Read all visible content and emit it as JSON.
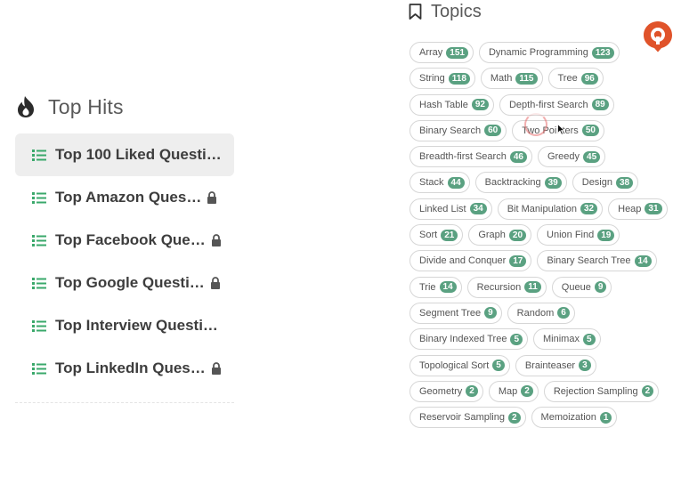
{
  "top_hits": {
    "title": "Top Hits",
    "items": [
      {
        "label": "Top 100 Liked Questi…",
        "locked": false,
        "active": true
      },
      {
        "label": "Top Amazon Ques…",
        "locked": true,
        "active": false
      },
      {
        "label": "Top Facebook Que…",
        "locked": true,
        "active": false
      },
      {
        "label": "Top Google Questi…",
        "locked": true,
        "active": false
      },
      {
        "label": "Top Interview Questi…",
        "locked": false,
        "active": false
      },
      {
        "label": "Top LinkedIn Ques…",
        "locked": true,
        "active": false
      }
    ]
  },
  "topics": {
    "title": "Topics",
    "tags": [
      {
        "name": "Array",
        "count": "151"
      },
      {
        "name": "Dynamic Programming",
        "count": "123"
      },
      {
        "name": "String",
        "count": "118"
      },
      {
        "name": "Math",
        "count": "115"
      },
      {
        "name": "Tree",
        "count": "96"
      },
      {
        "name": "Hash Table",
        "count": "92"
      },
      {
        "name": "Depth-first Search",
        "count": "89"
      },
      {
        "name": "Binary Search",
        "count": "60"
      },
      {
        "name": "Two Pointers",
        "count": "50"
      },
      {
        "name": "Breadth-first Search",
        "count": "46"
      },
      {
        "name": "Greedy",
        "count": "45"
      },
      {
        "name": "Stack",
        "count": "44"
      },
      {
        "name": "Backtracking",
        "count": "39"
      },
      {
        "name": "Design",
        "count": "38"
      },
      {
        "name": "Linked List",
        "count": "34"
      },
      {
        "name": "Bit Manipulation",
        "count": "32"
      },
      {
        "name": "Heap",
        "count": "31"
      },
      {
        "name": "Sort",
        "count": "21"
      },
      {
        "name": "Graph",
        "count": "20"
      },
      {
        "name": "Union Find",
        "count": "19"
      },
      {
        "name": "Divide and Conquer",
        "count": "17"
      },
      {
        "name": "Binary Search Tree",
        "count": "14"
      },
      {
        "name": "Trie",
        "count": "14"
      },
      {
        "name": "Recursion",
        "count": "11"
      },
      {
        "name": "Queue",
        "count": "9"
      },
      {
        "name": "Segment Tree",
        "count": "9"
      },
      {
        "name": "Random",
        "count": "6"
      },
      {
        "name": "Binary Indexed Tree",
        "count": "5"
      },
      {
        "name": "Minimax",
        "count": "5"
      },
      {
        "name": "Topological Sort",
        "count": "5"
      },
      {
        "name": "Brainteaser",
        "count": "3"
      },
      {
        "name": "Geometry",
        "count": "2"
      },
      {
        "name": "Map",
        "count": "2"
      },
      {
        "name": "Rejection Sampling",
        "count": "2"
      },
      {
        "name": "Reservoir Sampling",
        "count": "2"
      },
      {
        "name": "Memoization",
        "count": "1"
      }
    ]
  },
  "icons": {
    "top_hits": "flame-icon",
    "list_item": "list-icon",
    "locked": "lock-icon",
    "topics": "bookmark-icon",
    "brand": "leetcode-logo"
  },
  "colors": {
    "count_badge": "#5aa181",
    "list_icon": "#3aa86b",
    "active_row": "#eeeeee",
    "brand": "#e0532a"
  }
}
